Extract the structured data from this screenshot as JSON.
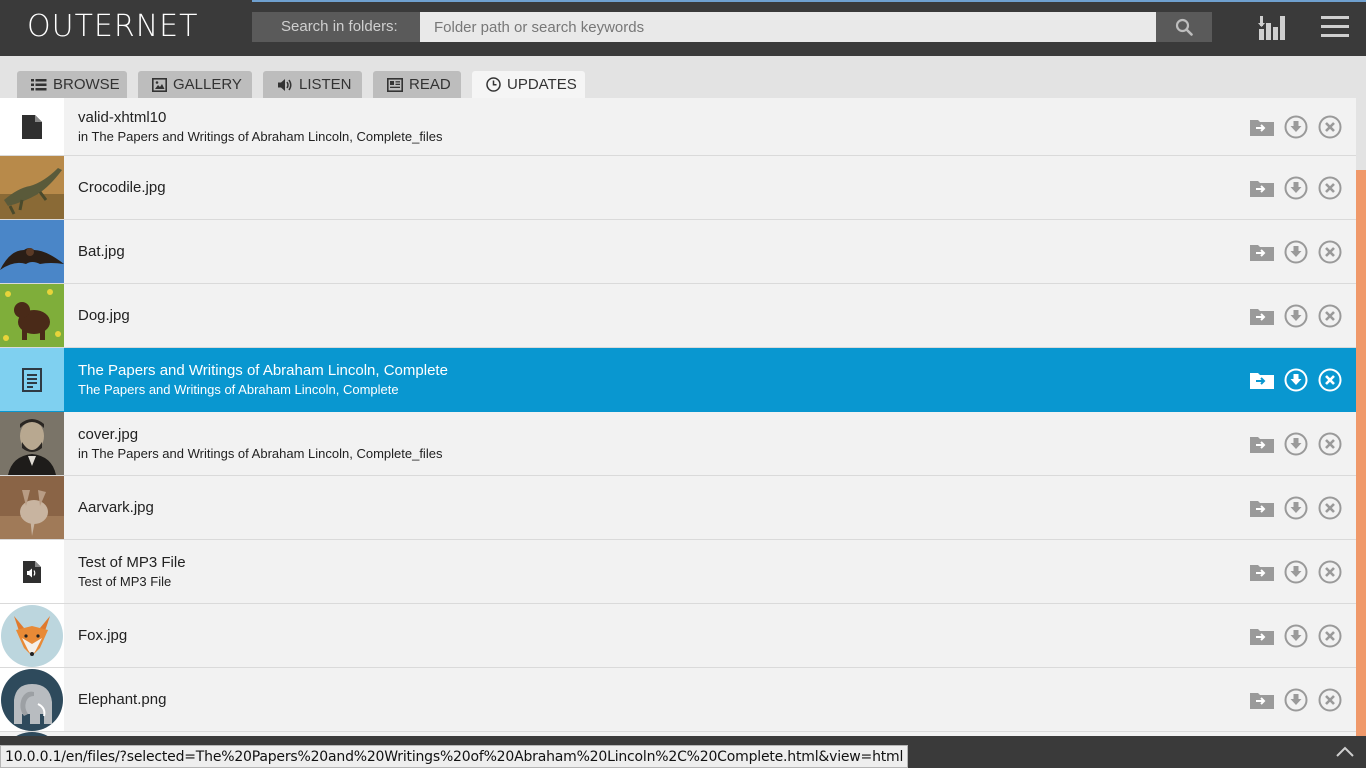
{
  "header": {
    "logo": "OUTERNET",
    "search_label": "Search in folders:",
    "search_placeholder": "Folder path or search keywords"
  },
  "tabs": [
    {
      "label": "BROWSE",
      "icon": "list-icon",
      "active": false
    },
    {
      "label": "GALLERY",
      "icon": "image-icon",
      "active": false
    },
    {
      "label": "LISTEN",
      "icon": "speaker-icon",
      "active": false
    },
    {
      "label": "READ",
      "icon": "newspaper-icon",
      "active": false
    },
    {
      "label": "UPDATES",
      "icon": "clock-icon",
      "active": true
    }
  ],
  "items": [
    {
      "title": "valid-xhtml10",
      "subtitle": "in The Papers and Writings of Abraham Lincoln, Complete_files",
      "thumb": "file-icon",
      "selected": false
    },
    {
      "title": "Crocodile.jpg",
      "subtitle": "",
      "thumb": "crocodile-photo",
      "selected": false
    },
    {
      "title": "Bat.jpg",
      "subtitle": "",
      "thumb": "bat-photo",
      "selected": false
    },
    {
      "title": "Dog.jpg",
      "subtitle": "",
      "thumb": "dog-photo",
      "selected": false
    },
    {
      "title": "The Papers and Writings of Abraham Lincoln, Complete",
      "subtitle": "The Papers and Writings of Abraham Lincoln, Complete",
      "thumb": "document-icon",
      "selected": true
    },
    {
      "title": "cover.jpg",
      "subtitle": "in The Papers and Writings of Abraham Lincoln, Complete_files",
      "thumb": "lincoln-portrait-photo",
      "selected": false
    },
    {
      "title": "Aarvark.jpg",
      "subtitle": "",
      "thumb": "aardvark-photo",
      "selected": false
    },
    {
      "title": "Test of MP3 File",
      "subtitle": "Test of MP3 File",
      "thumb": "audio-file-icon",
      "selected": false
    },
    {
      "title": "Fox.jpg",
      "subtitle": "",
      "thumb": "fox-illustration",
      "selected": false
    },
    {
      "title": "Elephant.png",
      "subtitle": "",
      "thumb": "elephant-illustration",
      "selected": false
    }
  ],
  "row_actions": [
    "open-folder-icon",
    "download-icon",
    "delete-icon"
  ],
  "status_url": "10.0.0.1/en/files/?selected=The%20Papers%20and%20Writings%20of%20Abraham%20Lincoln%2C%20Complete.html&view=html",
  "colors": {
    "header_bg": "#3a3a3a",
    "selected_row": "#0997d0",
    "scroll_thumb": "#f0996a"
  }
}
